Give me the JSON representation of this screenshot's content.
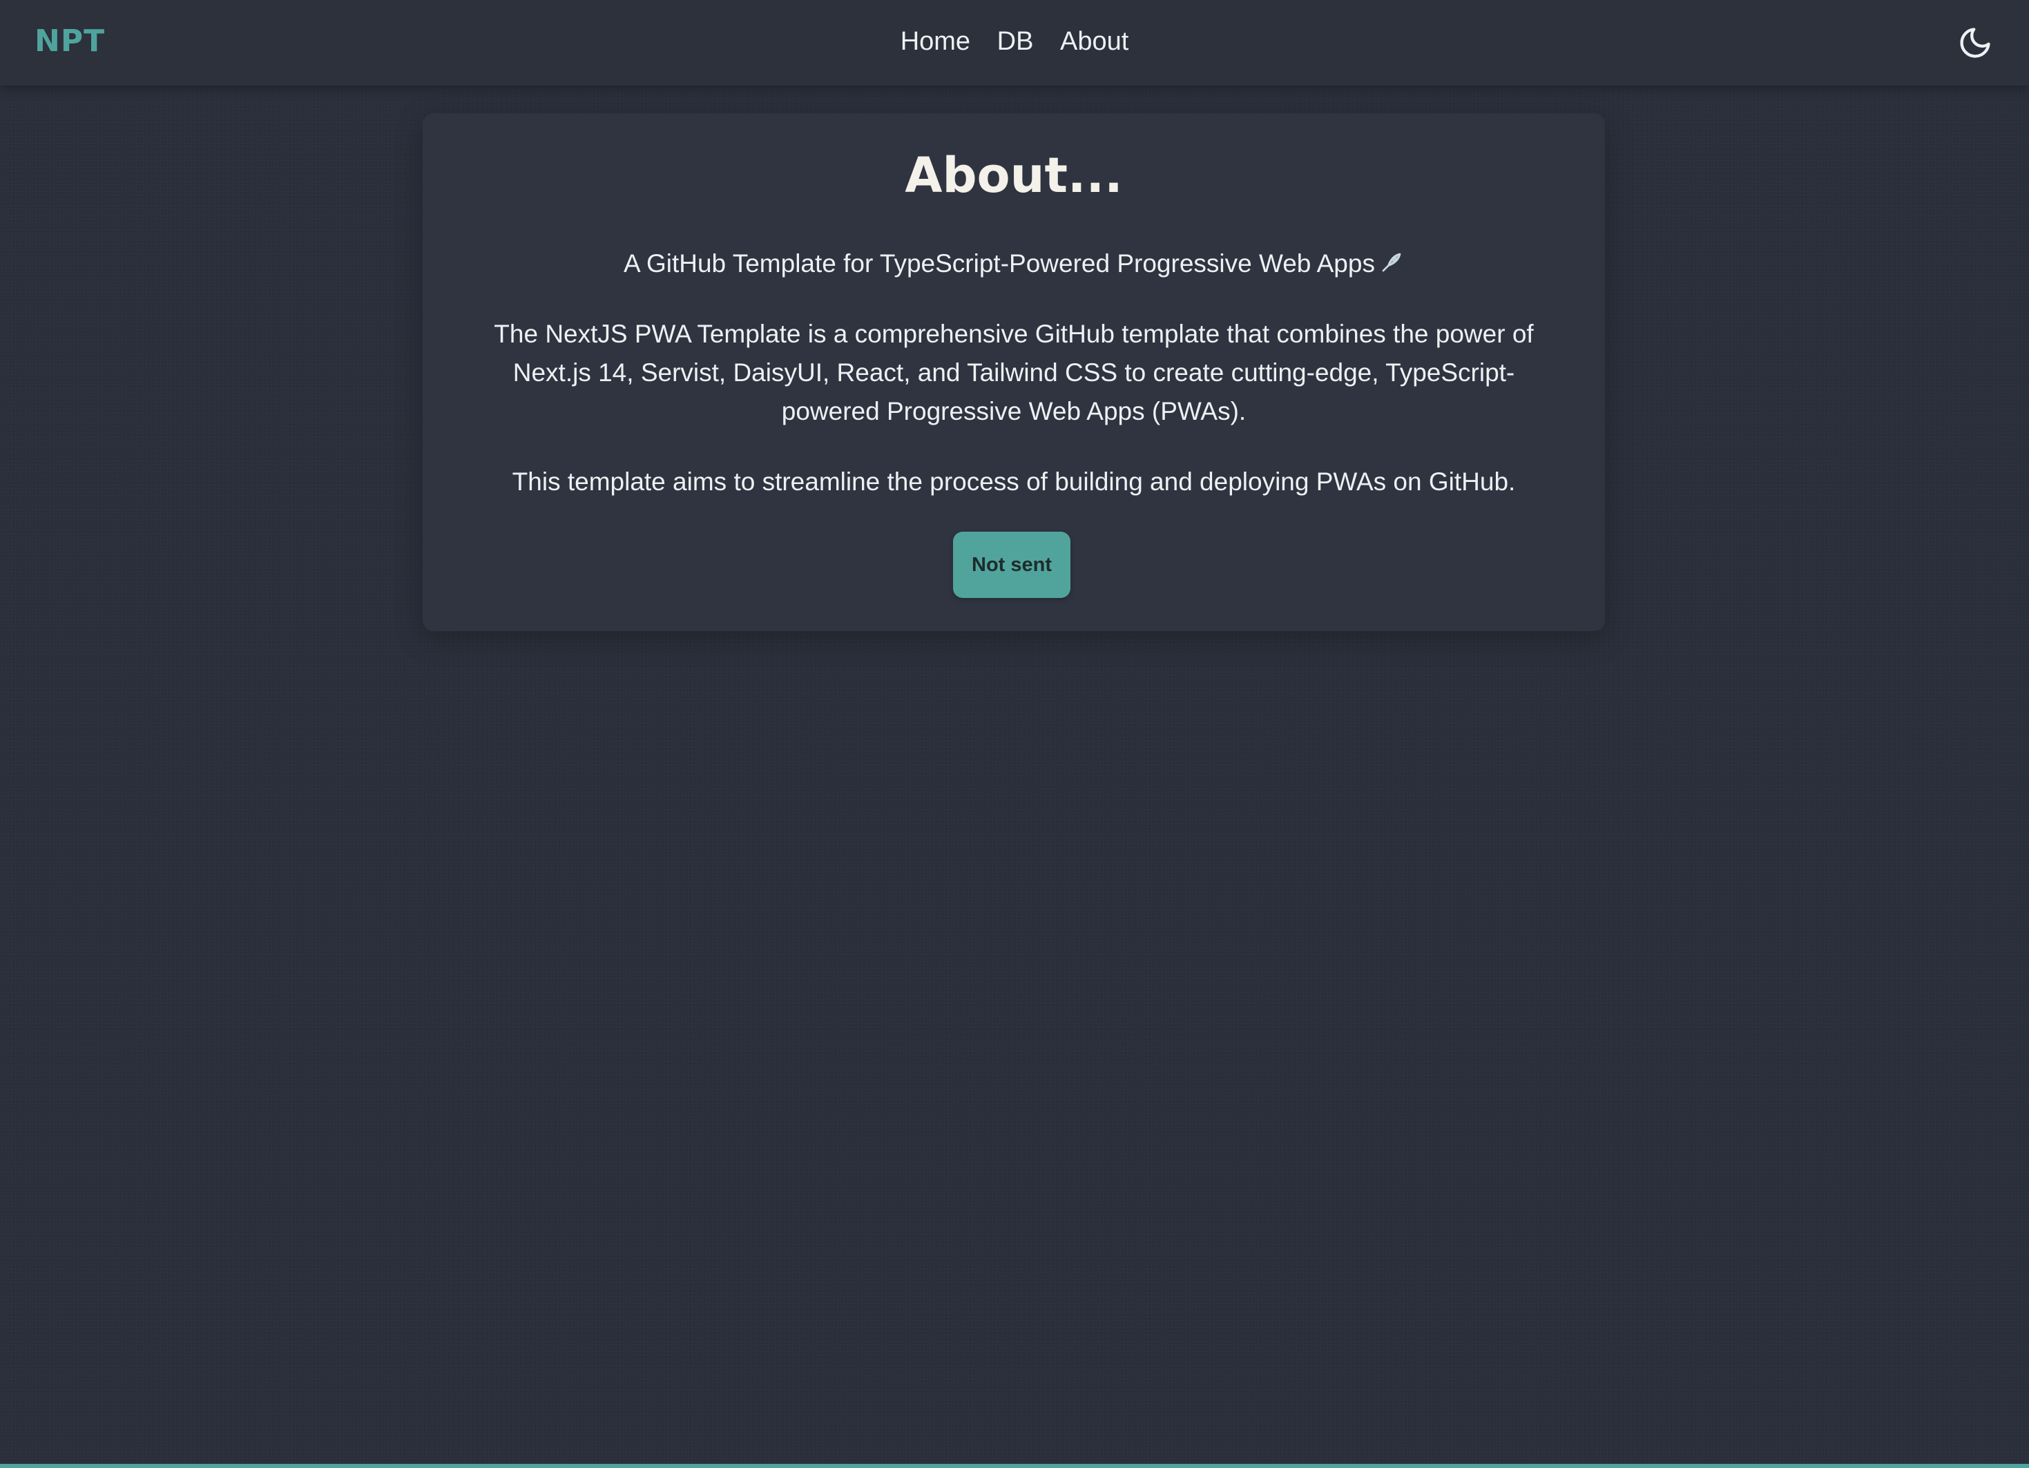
{
  "navbar": {
    "brand": "NPT",
    "links": [
      "Home",
      "DB",
      "About"
    ],
    "theme_icon": "moon-icon"
  },
  "card": {
    "title": "About...",
    "subtitle": "A GitHub Template for TypeScript-Powered Progressive Web Apps",
    "subtitle_icon": "rocket-icon",
    "paragraph": "The NextJS PWA Template is a comprehensive GitHub template that combines the power of Next.js 14, Servist, DaisyUI, React, and Tailwind CSS to create cutting-edge, TypeScript-powered Progressive Web Apps (PWAs).",
    "aim": "This template aims to streamline the process of building and deploying PWAs on GitHub.",
    "button_label": "Not sent"
  },
  "colors": {
    "background": "#2a2f3b",
    "navbar": "#2c313c",
    "card": "#2f3440",
    "accent": "#4fa49d",
    "button": "#51a49c",
    "text": "#eef0f3"
  }
}
